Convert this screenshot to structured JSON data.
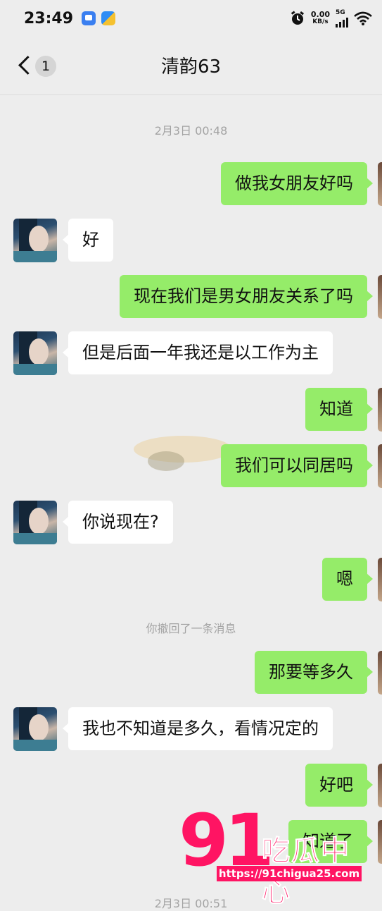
{
  "status_bar": {
    "time": "23:49",
    "speed_value": "0.00",
    "speed_unit": "KB/s",
    "network": "5G",
    "icons": [
      "app-icon-1",
      "app-icon-2",
      "alarm-icon",
      "signal-icon",
      "wifi-icon"
    ]
  },
  "nav": {
    "title": "清韵63",
    "unread_count": "1"
  },
  "chat": {
    "timestamp_1": "2月3日 00:48",
    "recall_notice": "你撤回了一条消息",
    "timestamp_2": "2月3日 00:51",
    "messages": [
      {
        "side": "out",
        "text": "做我女朋友好吗"
      },
      {
        "side": "in",
        "text": "好"
      },
      {
        "side": "out",
        "text": "现在我们是男女朋友关系了吗"
      },
      {
        "side": "in",
        "text": "但是后面一年我还是以工作为主"
      },
      {
        "side": "out",
        "text": "知道"
      },
      {
        "side": "out",
        "text": "我们可以同居吗"
      },
      {
        "side": "in",
        "text": "你说现在?"
      },
      {
        "side": "out",
        "text": "嗯"
      },
      {
        "side": "out",
        "text": "那要等多久"
      },
      {
        "side": "in",
        "text": "我也不知道是多久，看情况定的"
      },
      {
        "side": "out",
        "text": "好吧"
      },
      {
        "side": "out",
        "text": "知道了"
      }
    ]
  },
  "watermark": {
    "number": "91",
    "brand": "吃瓜中心",
    "url": "https://91chigua25.com"
  },
  "colors": {
    "background": "#ededed",
    "outgoing_bubble": "#95ec69",
    "incoming_bubble": "#ffffff",
    "watermark": "#ff1463"
  }
}
